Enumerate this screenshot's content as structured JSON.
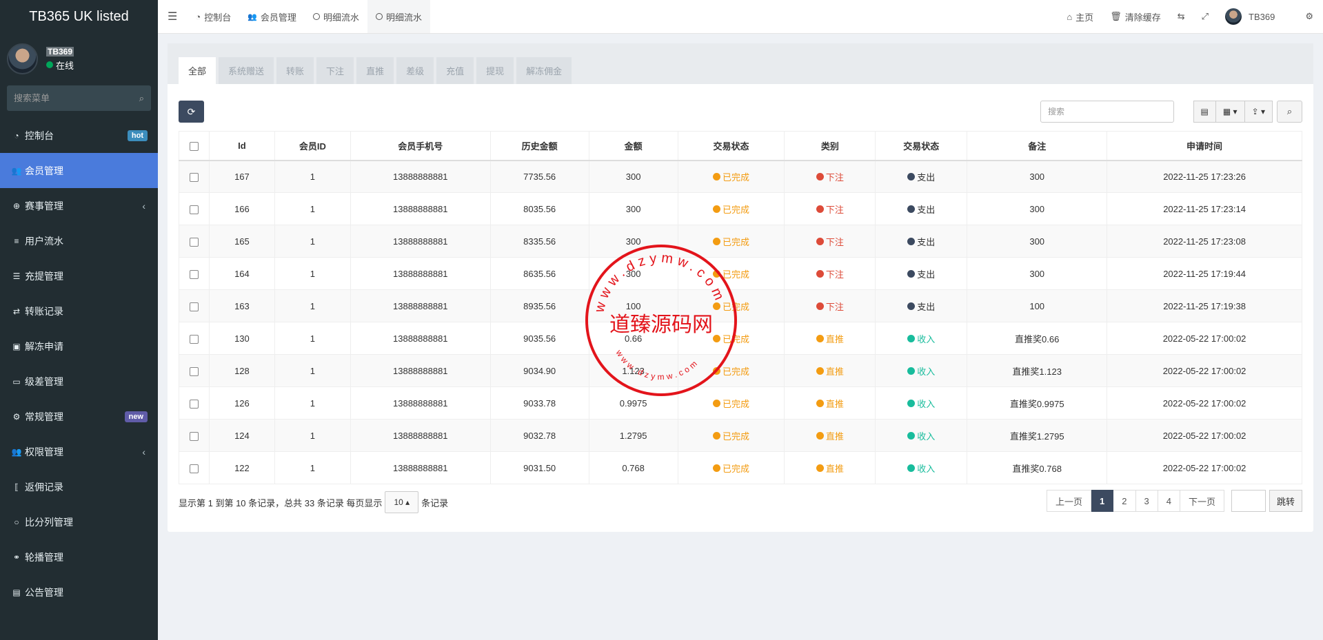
{
  "brand": "TB365 UK listed",
  "user": {
    "name": "TB369",
    "status": "在线"
  },
  "sidebar": {
    "search_placeholder": "搜索菜单",
    "items": [
      {
        "label": "控制台",
        "icon": "dashboard-icon",
        "glyph": "◔",
        "badge": "hot"
      },
      {
        "label": "会员管理",
        "icon": "users-icon",
        "glyph": "👥",
        "active": true
      },
      {
        "label": "赛事管理",
        "icon": "globe-icon",
        "glyph": "⊕",
        "chevron": "‹"
      },
      {
        "label": "用户流水",
        "icon": "list-icon",
        "glyph": "≡"
      },
      {
        "label": "充提管理",
        "icon": "tasks-icon",
        "glyph": "☰"
      },
      {
        "label": "转账记录",
        "icon": "exchange-icon",
        "glyph": "⇄"
      },
      {
        "label": "解冻申请",
        "icon": "image-icon",
        "glyph": "▣"
      },
      {
        "label": "级差管理",
        "icon": "window-icon",
        "glyph": "▭"
      },
      {
        "label": "常规管理",
        "icon": "cogs-icon",
        "glyph": "⚙",
        "badge": "new"
      },
      {
        "label": "权限管理",
        "icon": "group-icon",
        "glyph": "👥",
        "chevron": "‹"
      },
      {
        "label": "返佣记录",
        "icon": "bracket-icon",
        "glyph": "⟦"
      },
      {
        "label": "比分列管理",
        "icon": "circle-icon",
        "glyph": "○"
      },
      {
        "label": "轮播管理",
        "icon": "venus-icon",
        "glyph": "⚭"
      },
      {
        "label": "公告管理",
        "icon": "newspaper-icon",
        "glyph": "▤"
      }
    ]
  },
  "topbar": {
    "tabs": [
      {
        "label": "控制台",
        "icon": "dashboard-icon"
      },
      {
        "label": "会员管理",
        "icon": "users-icon"
      },
      {
        "label": "明细流水",
        "icon": "circle-icon"
      },
      {
        "label": "明细流水",
        "icon": "circle-icon",
        "active": true
      }
    ],
    "home_label": "主页",
    "clear_cache_label": "清除缓存",
    "username": "TB369"
  },
  "tabs": [
    {
      "label": "全部",
      "active": true
    },
    {
      "label": "系统赠送"
    },
    {
      "label": "转账"
    },
    {
      "label": "下注"
    },
    {
      "label": "直推"
    },
    {
      "label": "差级"
    },
    {
      "label": "充值"
    },
    {
      "label": "提现"
    },
    {
      "label": "解冻佣金"
    }
  ],
  "search_placeholder": "搜索",
  "table": {
    "headers": [
      "Id",
      "会员ID",
      "会员手机号",
      "历史金额",
      "金额",
      "交易状态",
      "类别",
      "交易状态",
      "备注",
      "申请时间"
    ],
    "rows": [
      {
        "id": "167",
        "member": "1",
        "phone": "13888888881",
        "hist": "7735.56",
        "amount": "300",
        "status": "已完成",
        "cat": "下注",
        "dir": "支出",
        "note": "300",
        "time": "2022-11-25 17:23:26"
      },
      {
        "id": "166",
        "member": "1",
        "phone": "13888888881",
        "hist": "8035.56",
        "amount": "300",
        "status": "已完成",
        "cat": "下注",
        "dir": "支出",
        "note": "300",
        "time": "2022-11-25 17:23:14"
      },
      {
        "id": "165",
        "member": "1",
        "phone": "13888888881",
        "hist": "8335.56",
        "amount": "300",
        "status": "已完成",
        "cat": "下注",
        "dir": "支出",
        "note": "300",
        "time": "2022-11-25 17:23:08"
      },
      {
        "id": "164",
        "member": "1",
        "phone": "13888888881",
        "hist": "8635.56",
        "amount": "300",
        "status": "已完成",
        "cat": "下注",
        "dir": "支出",
        "note": "300",
        "time": "2022-11-25 17:19:44"
      },
      {
        "id": "163",
        "member": "1",
        "phone": "13888888881",
        "hist": "8935.56",
        "amount": "100",
        "status": "已完成",
        "cat": "下注",
        "dir": "支出",
        "note": "100",
        "time": "2022-11-25 17:19:38"
      },
      {
        "id": "130",
        "member": "1",
        "phone": "13888888881",
        "hist": "9035.56",
        "amount": "0.66",
        "status": "已完成",
        "cat": "直推",
        "dir": "收入",
        "note": "直推奖0.66",
        "time": "2022-05-22 17:00:02"
      },
      {
        "id": "128",
        "member": "1",
        "phone": "13888888881",
        "hist": "9034.90",
        "amount": "1.123",
        "status": "已完成",
        "cat": "直推",
        "dir": "收入",
        "note": "直推奖1.123",
        "time": "2022-05-22 17:00:02"
      },
      {
        "id": "126",
        "member": "1",
        "phone": "13888888881",
        "hist": "9033.78",
        "amount": "0.9975",
        "status": "已完成",
        "cat": "直推",
        "dir": "收入",
        "note": "直推奖0.9975",
        "time": "2022-05-22 17:00:02"
      },
      {
        "id": "124",
        "member": "1",
        "phone": "13888888881",
        "hist": "9032.78",
        "amount": "1.2795",
        "status": "已完成",
        "cat": "直推",
        "dir": "收入",
        "note": "直推奖1.2795",
        "time": "2022-05-22 17:00:02"
      },
      {
        "id": "122",
        "member": "1",
        "phone": "13888888881",
        "hist": "9031.50",
        "amount": "0.768",
        "status": "已完成",
        "cat": "直推",
        "dir": "收入",
        "note": "直推奖0.768",
        "time": "2022-05-22 17:00:02"
      }
    ]
  },
  "colors": {
    "completed": "#f39c12",
    "bet": "#dd4b39",
    "direct": "#f39c12",
    "expense": "#3c4a60",
    "income": "#18bc9c",
    "accent": "#4a7bdc",
    "stamp": "#e3141b"
  },
  "footer": {
    "info": "显示第 1 到第 10 条记录，总共 33 条记录 每页显示",
    "page_size": "10",
    "suffix": "条记录"
  },
  "pager": {
    "prev": "上一页",
    "pages": [
      "1",
      "2",
      "3",
      "4"
    ],
    "current": "1",
    "next": "下一页",
    "jump": "跳转"
  },
  "watermark": {
    "title": "道臻源码网",
    "url": "www.dzymw.com"
  }
}
